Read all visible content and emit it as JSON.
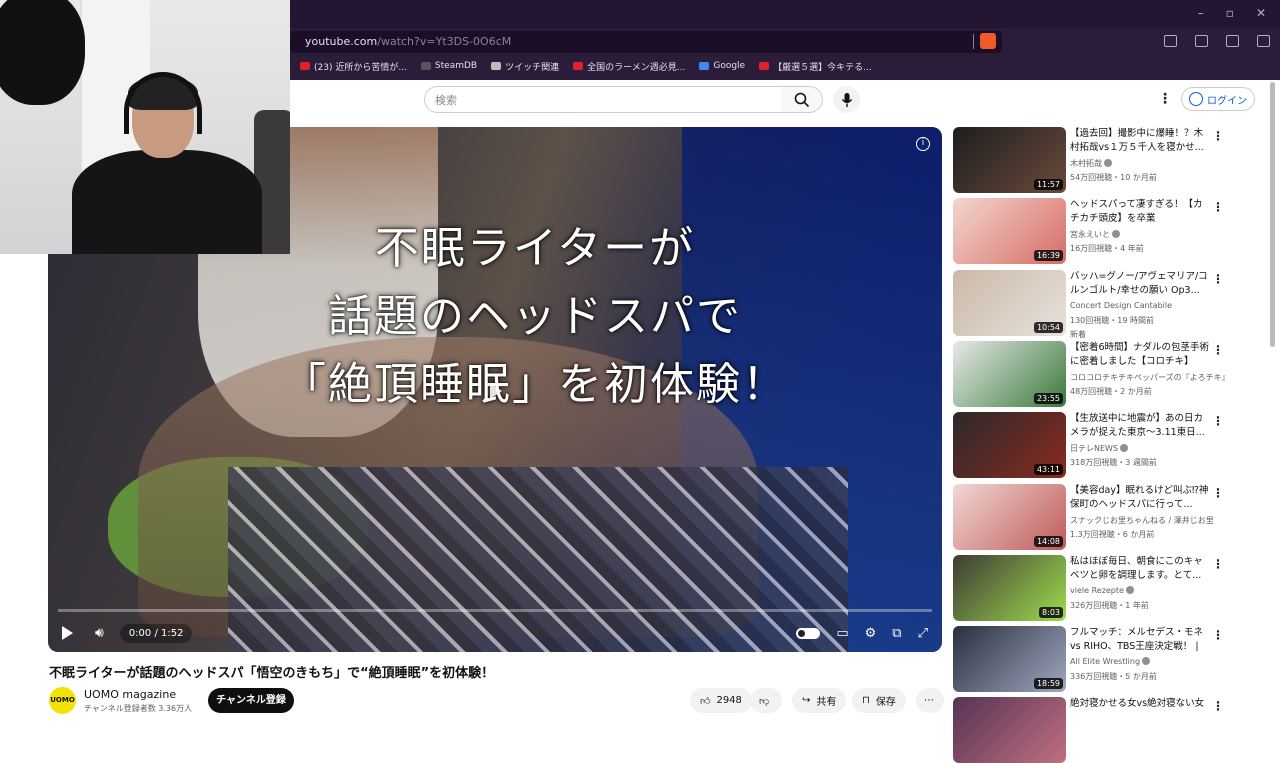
{
  "browser": {
    "url_host": "youtube.com",
    "url_path": "/watch?v=Yt3DS-0O6cM",
    "bookmarks": [
      {
        "label": "(23) 近所から苦情が...",
        "color": "#e0202a"
      },
      {
        "label": "SteamDB",
        "color": "#555555"
      },
      {
        "label": "ツイッチ関連",
        "color": "#bbbbbb"
      },
      {
        "label": "全国のラーメン週必見...",
        "color": "#e0202a"
      },
      {
        "label": "Google",
        "color": "#4285f4"
      },
      {
        "label": "【厳選５選】今キテる...",
        "color": "#e0202a"
      }
    ]
  },
  "header": {
    "search_placeholder": "検索",
    "login_label": "ログイン"
  },
  "player": {
    "caption_lines": [
      "不眠ライターが",
      "話題のヘッドスパで",
      "「絶頂睡眠」を初体験！"
    ],
    "time": "0:00 / 1:52",
    "progress": 0.0
  },
  "video": {
    "title": "不眠ライターが話題のヘッドスパ「悟空のきもち」で“絶頂睡眠”を初体験！",
    "channel_name": "UOMO magazine",
    "channel_avatar_text": "UOMO",
    "subscribers": "チャンネル登録者数 3.36万人",
    "subscribe_label": "チャンネル登録",
    "likes": "2948",
    "share_label": "共有",
    "save_label": "保存"
  },
  "recommendations": [
    {
      "title": "【過去回】撮影中に爆睡！？木村拓哉vs１万５千人を寝かせ...",
      "channel": "木村拓哉",
      "verified": true,
      "meta": "54万回視聴・10 か月前",
      "duration": "11:57",
      "badge": "",
      "thumb_colors": [
        "#1e1e1e",
        "#6b4a3c"
      ]
    },
    {
      "title": "ヘッドスパって凄すぎる！【カチカチ頭皮】を卒業",
      "channel": "宮永えいと",
      "verified": true,
      "meta": "16万回視聴・4 年前",
      "duration": "16:39",
      "badge": "",
      "thumb_colors": [
        "#f2d7cf",
        "#d86b66"
      ]
    },
    {
      "title": "バッハ=グノー/アヴェマリア/コルンゴルト/幸せの願い Op3...",
      "channel": "Concert Design Cantabile",
      "verified": false,
      "meta": "130回視聴・19 時間前",
      "duration": "10:54",
      "badge": "新着",
      "thumb_colors": [
        "#cbb9a8",
        "#e7e2dc"
      ]
    },
    {
      "title": "【密着6時間】ナダルの包茎手術に密着しました【コロチキ】",
      "channel": "コロコロチキチキペッパーズの『よろチキ』",
      "verified": false,
      "meta": "48万回視聴・2 か月前",
      "duration": "23:55",
      "badge": "",
      "thumb_colors": [
        "#e9e9e9",
        "#3b7a3b"
      ]
    },
    {
      "title": "【生放送中に地震が】あの日カメラが捉えた東京～3.11東日...",
      "channel": "日テレNEWS",
      "verified": true,
      "meta": "318万回視聴・3 週間前",
      "duration": "43:11",
      "badge": "",
      "thumb_colors": [
        "#2a2a2a",
        "#8a2a20"
      ]
    },
    {
      "title": "【美容day】眠れるけど叫ぶ⁉神保町のヘッドスパに行って...",
      "channel": "スナックじお里ちゃんねる / 澤井じお里",
      "verified": false,
      "meta": "1.3万回視聴・6 か月前",
      "duration": "14:08",
      "badge": "",
      "thumb_colors": [
        "#f0d8d4",
        "#c05a5a"
      ]
    },
    {
      "title": "私はほぼ毎日、朝食にこのキャベツと卵を調理します。とて...",
      "channel": "viele Rezepte",
      "verified": true,
      "meta": "326万回視聴・1 年前",
      "duration": "8:03",
      "badge": "",
      "thumb_colors": [
        "#3d3b36",
        "#9fdc4d"
      ]
    },
    {
      "title": "フルマッチ：メルセデス・モネvs RIHO、TBS王座決定戦！ | ...",
      "channel": "All Elite Wrestling",
      "verified": true,
      "meta": "336万回視聴・5 か月前",
      "duration": "18:59",
      "badge": "",
      "thumb_colors": [
        "#2a2f3f",
        "#a0a8c0"
      ]
    },
    {
      "title": "絶対寝かせる女vs絶対寝ない女",
      "channel": "",
      "verified": false,
      "meta": "",
      "duration": "",
      "badge": "",
      "thumb_colors": [
        "#553355",
        "#c07080"
      ]
    }
  ]
}
